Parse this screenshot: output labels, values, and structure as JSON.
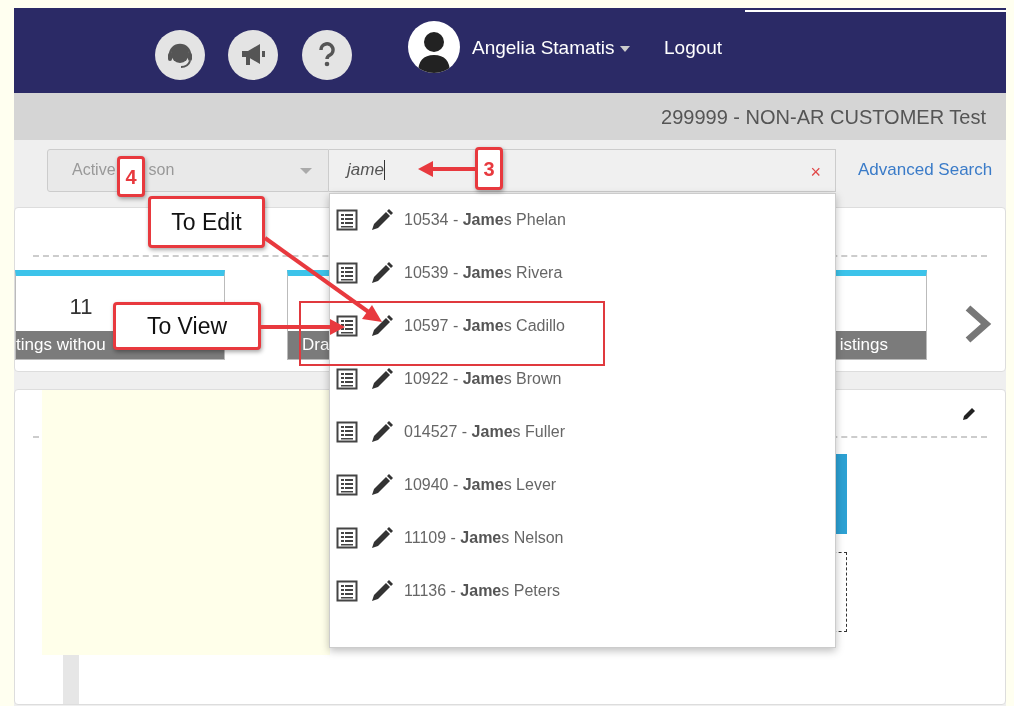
{
  "header": {
    "user": "Angelia Stamatis",
    "logout": "Logout"
  },
  "customer_bar": {
    "title": "299999 - NON-AR CUSTOMER Test"
  },
  "search": {
    "filter_parts": [
      "Active",
      "son"
    ],
    "value": "jame",
    "clear_symbol": "×",
    "advanced_link": "Advanced Search"
  },
  "tiles": [
    {
      "count": "11",
      "label": "tings withou"
    },
    {
      "label": "Dra"
    },
    {
      "label": "istings"
    }
  ],
  "results": [
    {
      "text": "10534 - **Jame**s Phelan",
      "boxed": false
    },
    {
      "text": "10539 - **Jame**s Rivera",
      "boxed": false
    },
    {
      "text": "10597 - **Jame**s Cadillo",
      "boxed": true
    },
    {
      "text": "10922 - **Jame**s Brown",
      "boxed": false
    },
    {
      "text": "014527 - **Jame**s Fuller",
      "boxed": false
    },
    {
      "text": "10940 - **Jame**s Lever",
      "boxed": false
    },
    {
      "text": "11109 - **Jame**s Nelson",
      "boxed": false
    },
    {
      "text": "11136 - **Jame**s Peters",
      "boxed": false
    }
  ],
  "annotations": [
    {
      "kind": "number",
      "text": "3"
    },
    {
      "kind": "number",
      "text": "4"
    },
    {
      "kind": "callout",
      "text": "To Edit"
    },
    {
      "kind": "callout",
      "text": "To View"
    }
  ]
}
